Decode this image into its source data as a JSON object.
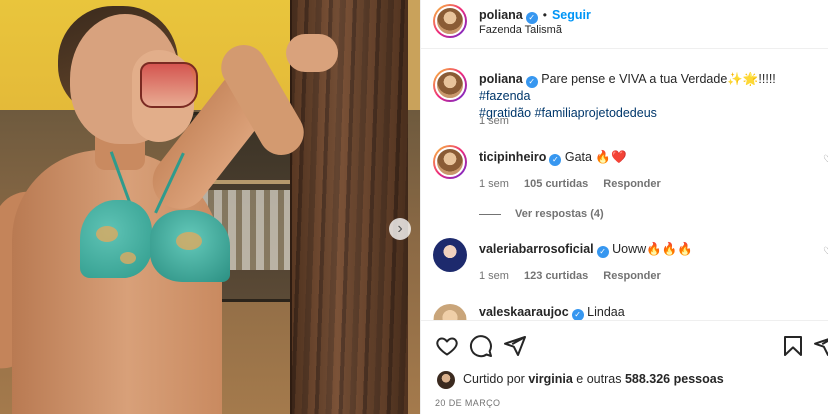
{
  "post": {
    "author": "poliana",
    "follow_label": "Seguir",
    "separator": "•",
    "location": "Fazenda Talismã",
    "verified_glyph": "✓"
  },
  "caption": {
    "author": "poliana",
    "text": "Pare pense e VIVA a tua Verdade✨🌟!!!!!",
    "hashtags_line1": "#fazenda",
    "hashtags_line2": "#gratidão #familiaprojetodedeus",
    "age": "1 sem"
  },
  "comments": [
    {
      "author": "ticipinheiro",
      "text": "Gata 🔥❤️",
      "age": "1 sem",
      "likes": "105 curtidas",
      "reply": "Responder",
      "view_replies": "Ver respostas (4)"
    },
    {
      "author": "valeriabarrosoficial",
      "text": "Uoww🔥🔥🔥",
      "age": "1 sem",
      "likes": "123 curtidas",
      "reply": "Responder"
    },
    {
      "author": "valeskaaraujoc",
      "text": "Lindaa"
    }
  ],
  "actions": {
    "like_icon": "heart-icon",
    "comment_icon": "comment-icon",
    "share_icon": "share-icon",
    "save_icon": "bookmark-icon"
  },
  "likes_summary": {
    "prefix": "Curtido por",
    "user": "virginia",
    "middle": "e outras",
    "count": "588.326",
    "suffix": "pessoas"
  },
  "date": "20 DE MARÇO",
  "carousel": {
    "next_glyph": "›"
  },
  "colors": {
    "link_blue": "#0095f6",
    "verified": "#3797f0",
    "hashtag": "#00376b",
    "muted": "#737373"
  }
}
